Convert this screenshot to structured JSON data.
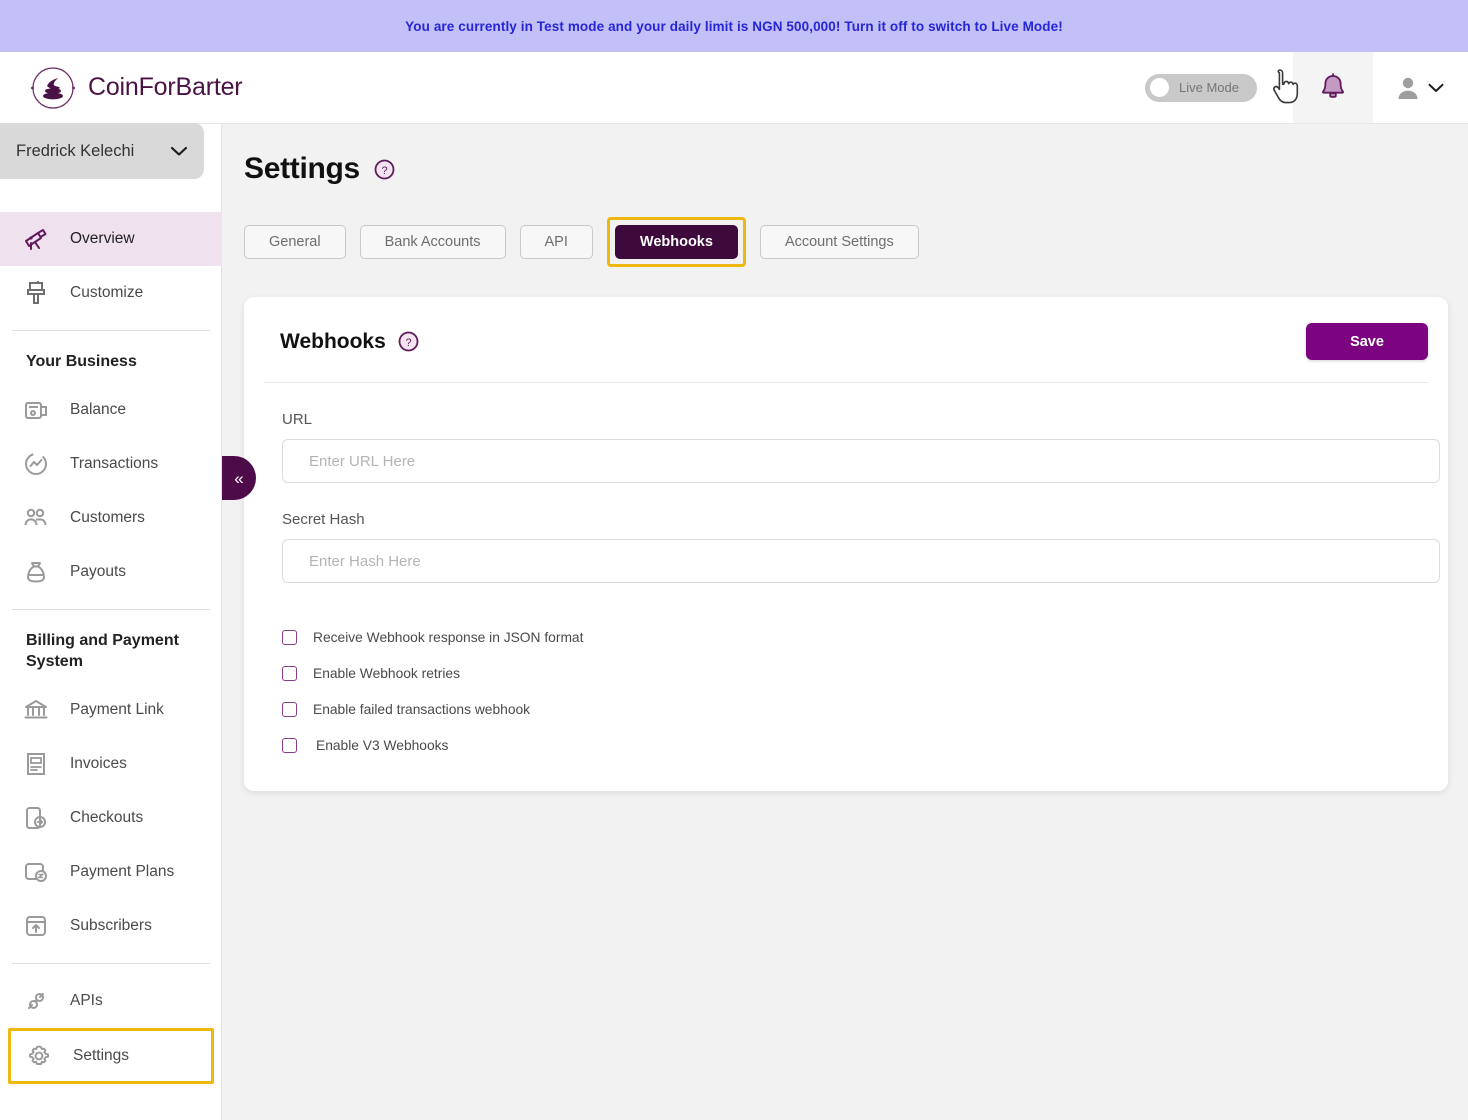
{
  "banner": {
    "text": "You are currently in Test mode and your daily limit is NGN 500,000! Turn it off to switch to Live Mode!",
    "bg_color": "#c2c0f7",
    "text_color": "#2626d6"
  },
  "topbar": {
    "brand_name": "CoinForBarter",
    "brand_icon": "coinforbarter-logo-icon",
    "live_mode_label": "Live Mode",
    "live_mode_on": false,
    "bell_icon": "notification-bell-icon",
    "cursor_icon": "pointer-hand-cursor-icon",
    "avatar_icon": "user-avatar-icon",
    "chevron_icon": "chevron-down-icon"
  },
  "sidebar": {
    "profile_name": "Fredrick Kelechi",
    "profile_chevron_icon": "chevron-down-icon",
    "collapse_icon": "double-chevron-left-icon",
    "top_items": [
      {
        "label": "Overview",
        "icon": "telescope-icon",
        "active": true
      },
      {
        "label": "Customize",
        "icon": "paint-brush-icon",
        "active": false
      }
    ],
    "business_heading": "Your Business",
    "business_items": [
      {
        "label": "Balance",
        "icon": "wallet-icon"
      },
      {
        "label": "Transactions",
        "icon": "transactions-chart-icon"
      },
      {
        "label": "Customers",
        "icon": "customers-group-icon"
      },
      {
        "label": "Payouts",
        "icon": "money-bag-icon"
      }
    ],
    "billing_heading": "Billing and Payment System",
    "billing_items": [
      {
        "label": "Payment Link",
        "icon": "bank-building-icon"
      },
      {
        "label": "Invoices",
        "icon": "invoice-document-icon"
      },
      {
        "label": "Checkouts",
        "icon": "checkout-arrow-icon"
      },
      {
        "label": "Payment Plans",
        "icon": "payment-plan-icon"
      },
      {
        "label": "Subscribers",
        "icon": "subscribers-icon"
      }
    ],
    "footer_items": [
      {
        "label": "APIs",
        "icon": "plug-connector-icon",
        "highlighted": false
      },
      {
        "label": "Settings",
        "icon": "gear-icon",
        "highlighted": true
      }
    ]
  },
  "main": {
    "page_title": "Settings",
    "page_help_icon": "question-mark-circle-icon",
    "tabs": [
      {
        "label": "General",
        "active": false,
        "ring": false
      },
      {
        "label": "Bank Accounts",
        "active": false,
        "ring": false
      },
      {
        "label": "API",
        "active": false,
        "ring": false
      },
      {
        "label": "Webhooks",
        "active": true,
        "ring": true
      },
      {
        "label": "Account Settings",
        "active": false,
        "ring": false
      }
    ],
    "card": {
      "title": "Webhooks",
      "help_icon": "question-mark-circle-icon",
      "save_label": "Save",
      "fields": [
        {
          "label": "URL",
          "value": "",
          "placeholder": "Enter URL Here"
        },
        {
          "label": "Secret Hash",
          "value": "",
          "placeholder": "Enter Hash Here"
        }
      ],
      "checkboxes": [
        {
          "label": "Receive Webhook response in JSON format",
          "checked": false
        },
        {
          "label": "Enable Webhook retries",
          "checked": false
        },
        {
          "label": "Enable failed transactions webhook",
          "checked": false
        },
        {
          "label": "Enable V3 Webhooks",
          "checked": false
        }
      ]
    }
  },
  "colors": {
    "brand_purple": "#4a1345",
    "accent_purple": "#7d0480",
    "active_tab": "#3d0a3b",
    "highlight_gold": "#efb810",
    "page_bg": "#f2f2f2",
    "sidebar_active": "#f0e1ef"
  }
}
